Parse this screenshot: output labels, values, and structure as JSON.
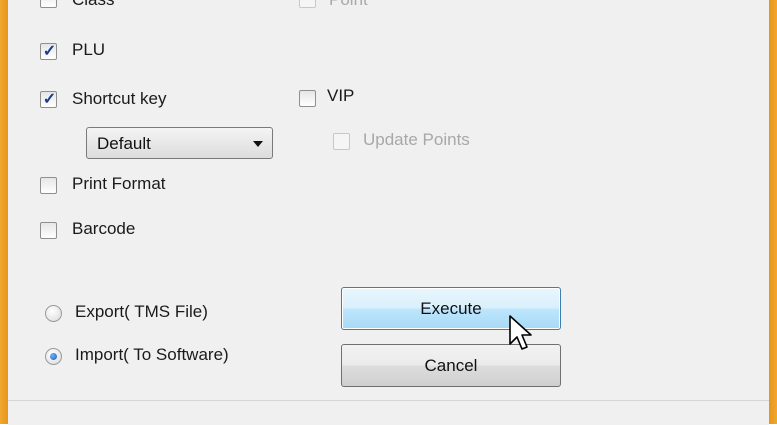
{
  "checkboxes_left": {
    "class": {
      "label": "Class",
      "checked": false
    },
    "plu": {
      "label": "PLU",
      "checked": true
    },
    "shortcut_key": {
      "label": "Shortcut key",
      "checked": true
    },
    "print_format": {
      "label": "Print Format",
      "checked": false
    },
    "barcode": {
      "label": "Barcode",
      "checked": false
    }
  },
  "shortcut_dropdown": {
    "selected": "Default"
  },
  "checkboxes_right": {
    "point": {
      "label": "Point",
      "checked": false,
      "enabled": false
    },
    "vip": {
      "label": "VIP",
      "checked": false,
      "enabled": true
    },
    "update_points": {
      "label": "Update Points",
      "checked": false,
      "enabled": false
    }
  },
  "mode": {
    "export": {
      "label": "Export( TMS File)",
      "selected": false
    },
    "import": {
      "label": "Import( To Software)",
      "selected": true
    }
  },
  "buttons": {
    "execute": "Execute",
    "cancel": "Cancel"
  },
  "colors": {
    "window_frame": "#f0a830",
    "panel_bg": "#f0f0f0",
    "checkmark": "#1c3c8c",
    "hot_button": "#bee6fd"
  },
  "icons": {
    "cursor": "mouse-pointer-icon",
    "checkmark": "checkmark-icon",
    "dropdown_arrow": "chevron-down-icon"
  }
}
